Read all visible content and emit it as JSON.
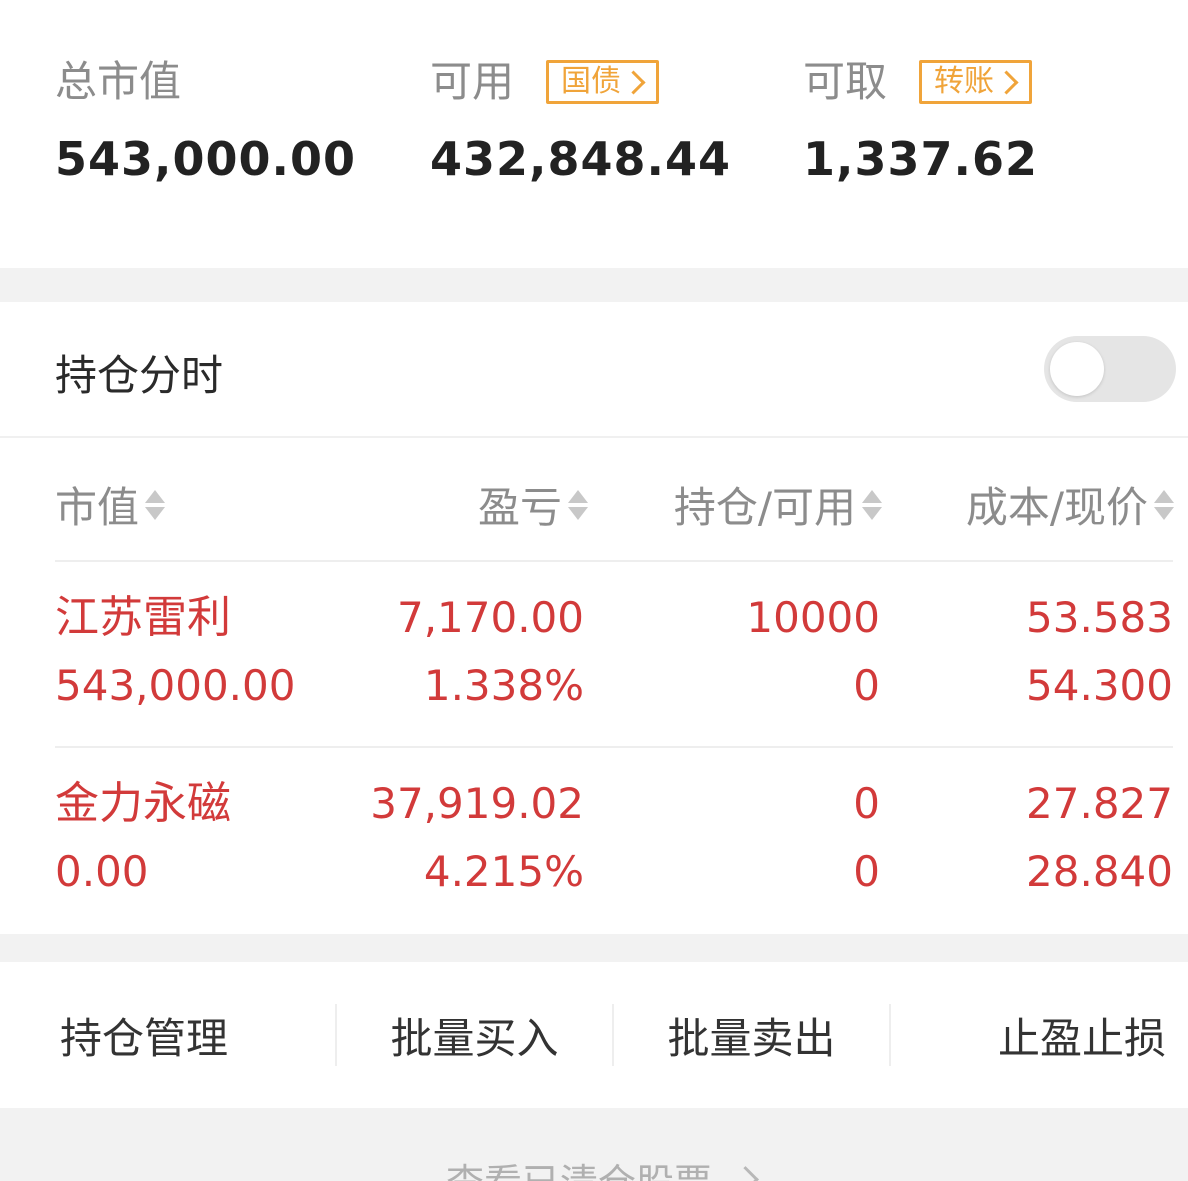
{
  "summary": {
    "total_market_value": {
      "label": "总市值",
      "value": "543,000.00"
    },
    "available": {
      "label": "可用",
      "tag": "国债",
      "value": "432,848.44"
    },
    "withdrawable": {
      "label": "可取",
      "tag": "转账",
      "value": "1,337.62"
    }
  },
  "position_timeline": {
    "label": "持仓分时",
    "enabled": false
  },
  "table": {
    "headers": [
      "市值",
      "盈亏",
      "持仓/可用",
      "成本/现价"
    ],
    "rows": [
      {
        "name": "江苏雷利",
        "market_value": "543,000.00",
        "pnl": "7,170.00",
        "pnl_pct": "1.338%",
        "position": "10000",
        "available": "0",
        "cost": "53.583",
        "price": "54.300"
      },
      {
        "name": "金力永磁",
        "market_value": "0.00",
        "pnl": "37,919.02",
        "pnl_pct": "4.215%",
        "position": "0",
        "available": "0",
        "cost": "27.827",
        "price": "28.840"
      }
    ]
  },
  "actions": [
    "持仓管理",
    "批量买入",
    "批量卖出",
    "止盈止损"
  ],
  "footer": {
    "cleared_link": "查看已清仓股票"
  },
  "colors": {
    "accent_tag": "#f0a43a",
    "gain_red": "#d23a3a",
    "muted": "#8c8c8c"
  }
}
